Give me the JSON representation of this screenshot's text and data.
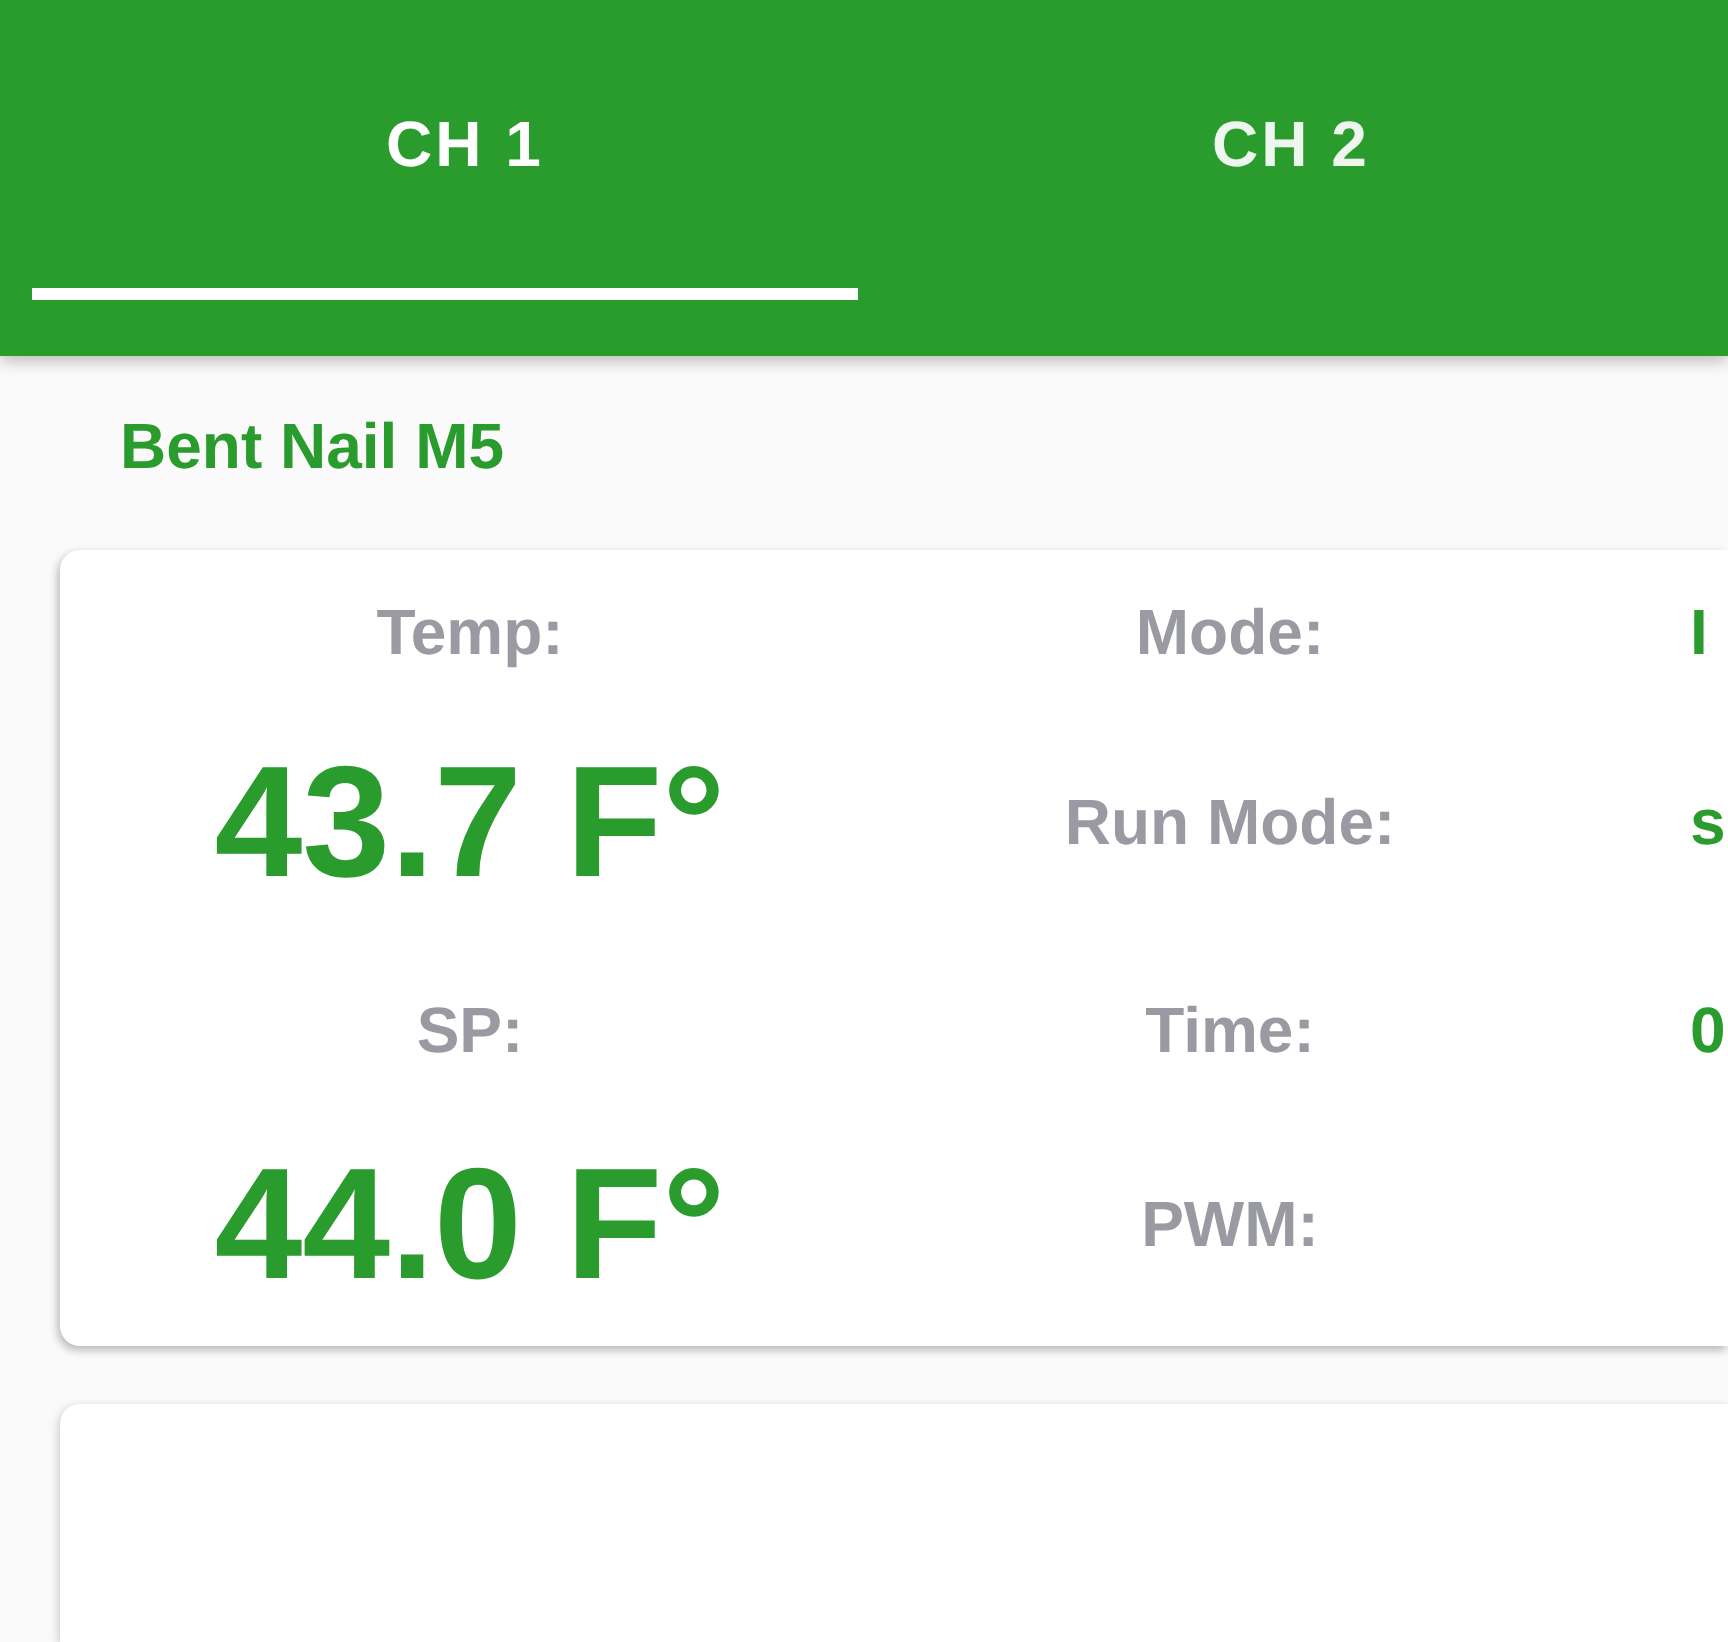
{
  "tabs": [
    {
      "label": "CH 1",
      "selected": true
    },
    {
      "label": "CH 2",
      "selected": false
    }
  ],
  "device_name": "Bent Nail M5",
  "status_card": {
    "readings": [
      {
        "label": "Temp:",
        "value": "43.7 F°"
      },
      {
        "label": "SP:",
        "value": "44.0 F°"
      }
    ],
    "fields": [
      {
        "label": "Mode:",
        "value": "I"
      },
      {
        "label": "Run Mode:",
        "value": "s"
      },
      {
        "label": "Time:",
        "value": "0"
      },
      {
        "label": "PWM:"
      }
    ]
  }
}
